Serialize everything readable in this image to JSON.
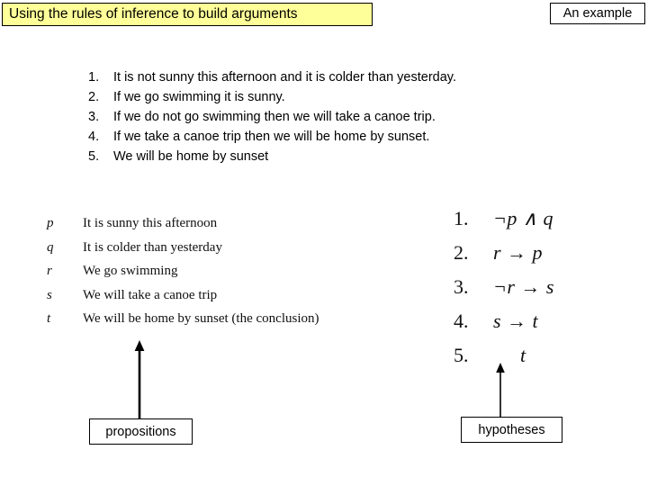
{
  "slide": {
    "title": "Using the rules of inference to build arguments",
    "corner_label": "An example",
    "title_bg_color": "#ffff99",
    "text_color": "#000000"
  },
  "argument": {
    "items": [
      {
        "num": "1.",
        "text": "It is not sunny this afternoon and it is colder than yesterday."
      },
      {
        "num": "2.",
        "text": "If we go swimming it is sunny."
      },
      {
        "num": "3.",
        "text": "If we do not go swimming then we will take a canoe trip."
      },
      {
        "num": "4.",
        "text": "If we take a canoe trip then we will be home by sunset."
      },
      {
        "num": "5.",
        "text": "We will be home by sunset"
      }
    ]
  },
  "propositions": {
    "items": [
      {
        "var": "p",
        "desc": "It is sunny this afternoon"
      },
      {
        "var": "q",
        "desc": "It is colder than yesterday"
      },
      {
        "var": "r",
        "desc": "We go swimming"
      },
      {
        "var": "s",
        "desc": "We will take a canoe trip"
      },
      {
        "var": "t",
        "desc": "We will be home by sunset (the conclusion)"
      }
    ],
    "callout_label": "propositions"
  },
  "hypotheses": {
    "items": [
      {
        "num": "1.",
        "formula": "¬p ∧ q"
      },
      {
        "num": "2.",
        "formula": "r → p"
      },
      {
        "num": "3.",
        "formula": "¬r → s"
      },
      {
        "num": "4.",
        "formula": "s → t"
      },
      {
        "num": "5.",
        "formula": "t"
      }
    ],
    "callout_label": "hypotheses"
  }
}
